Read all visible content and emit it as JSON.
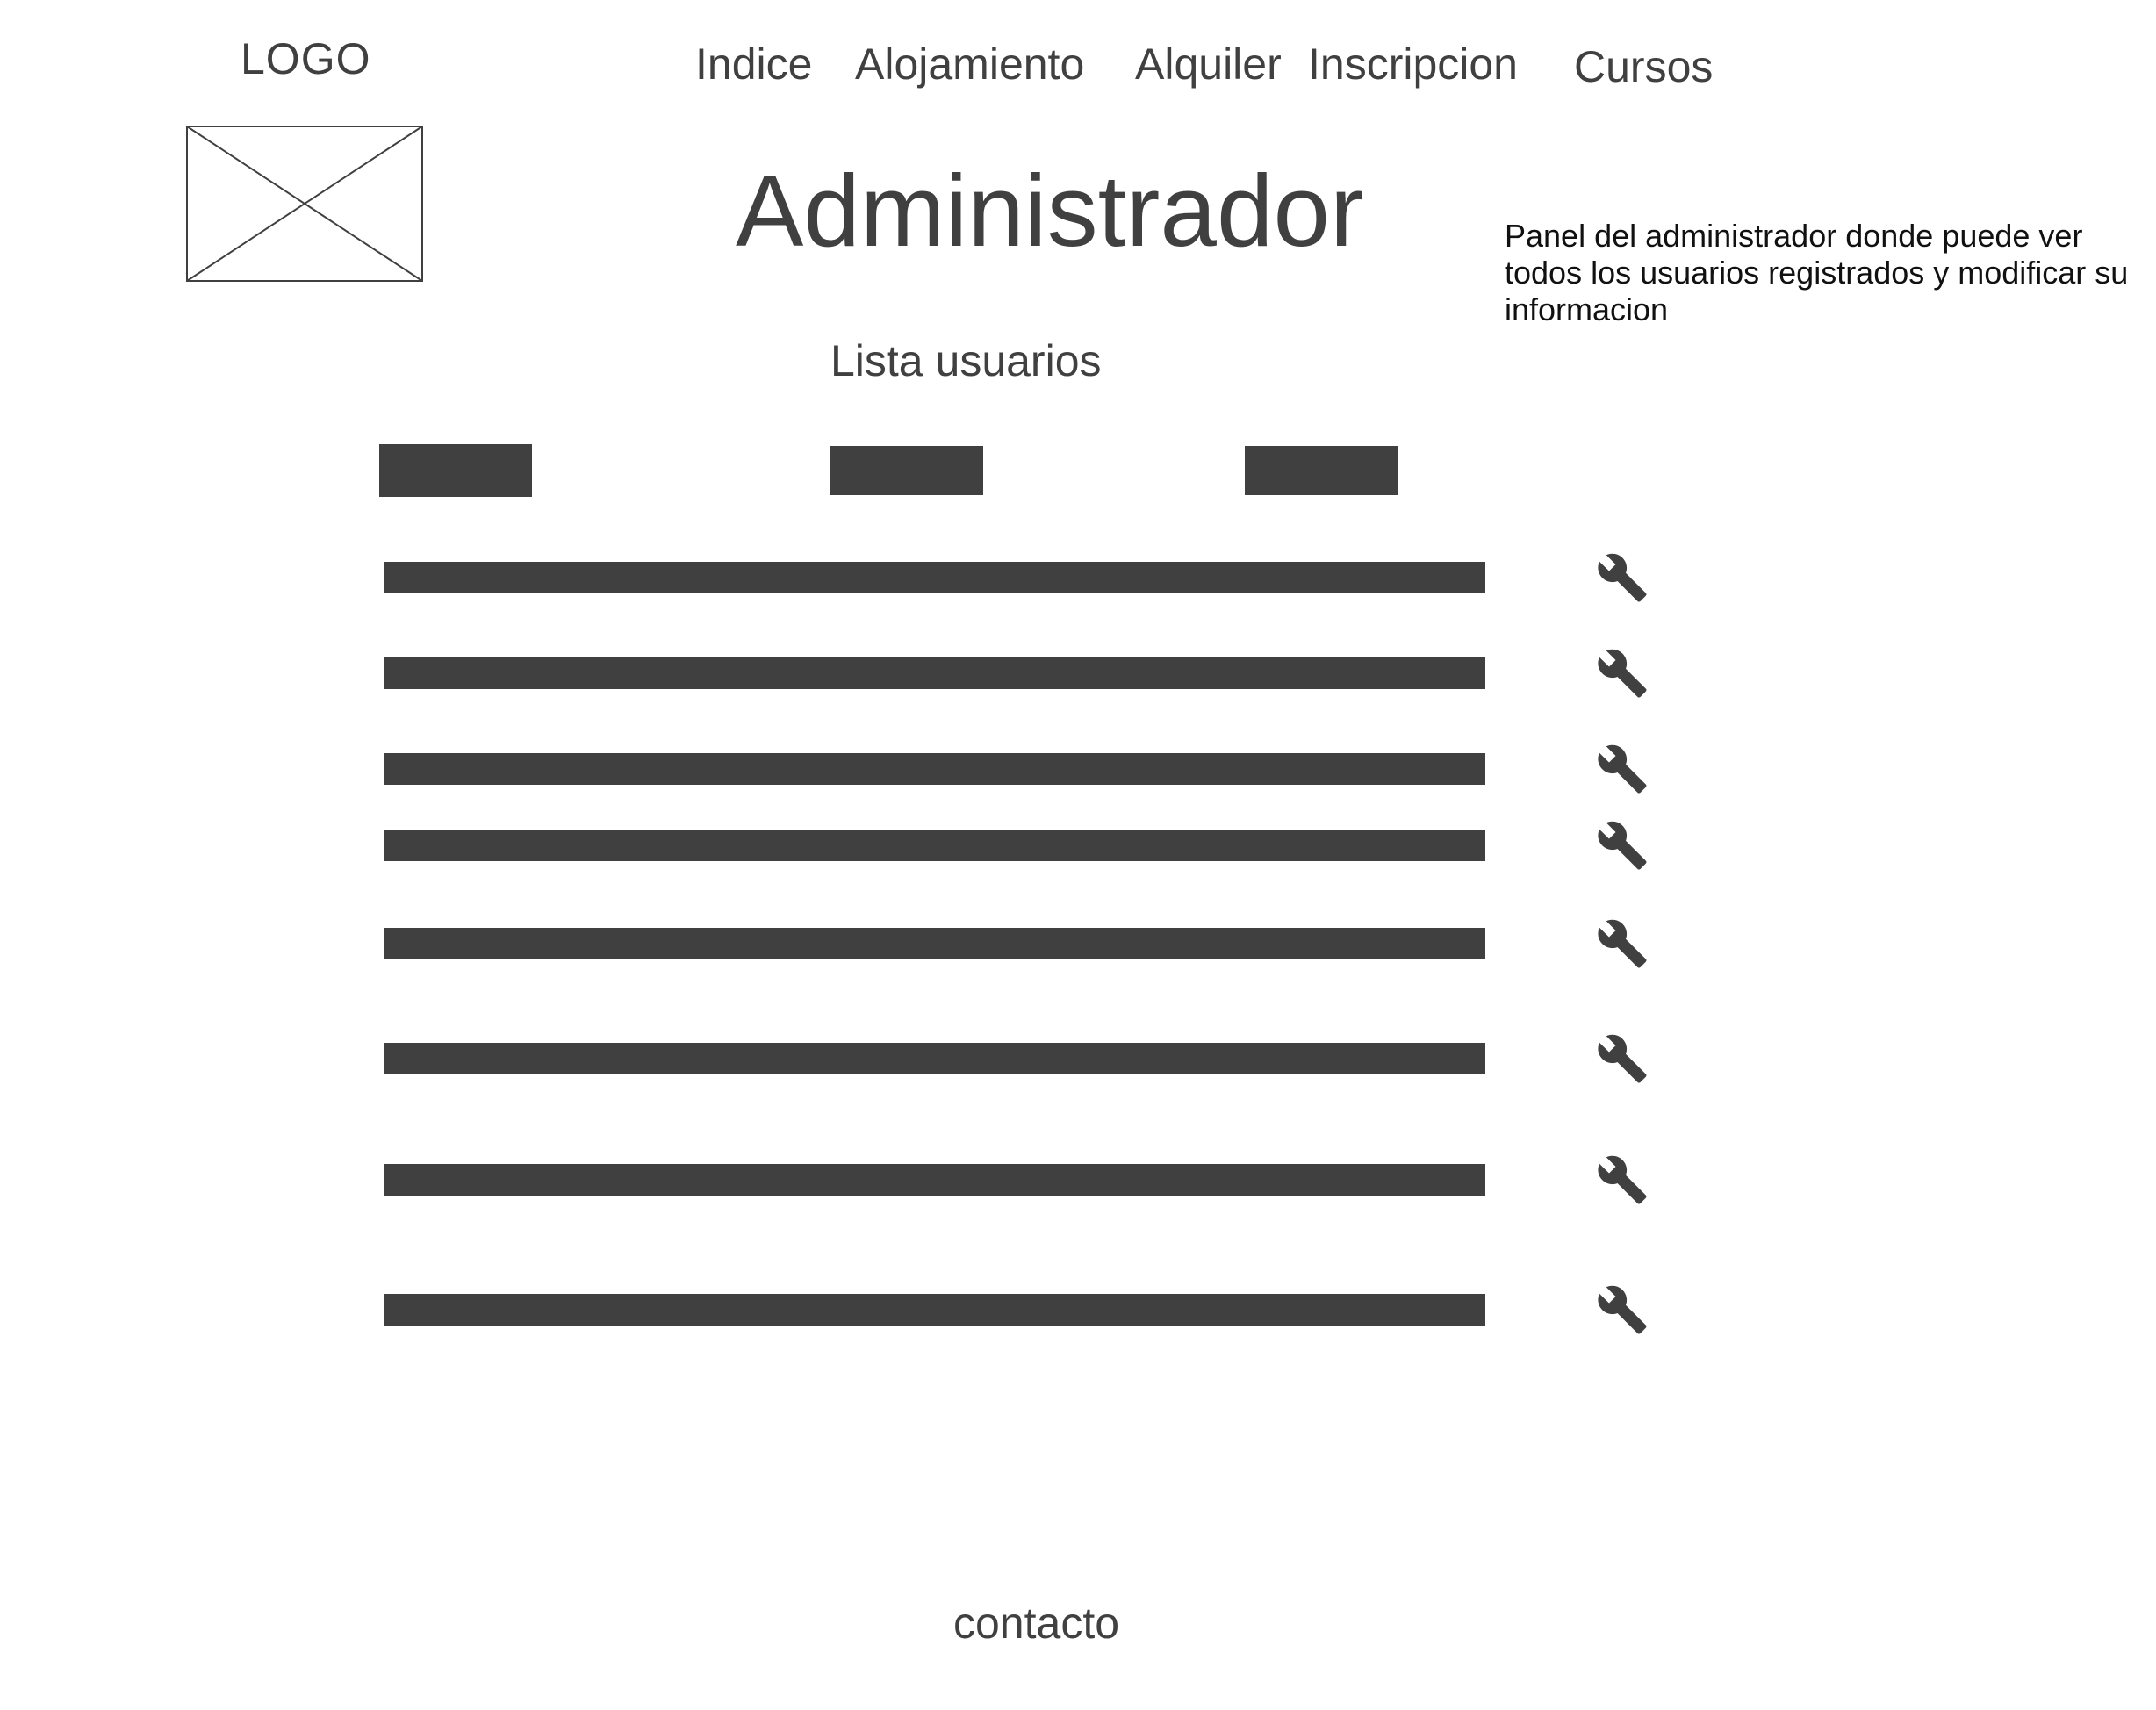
{
  "header": {
    "logo_label": "LOGO",
    "nav": {
      "indice": "Indice",
      "alojamiento": "Alojamiento",
      "alquiler": "Alquiler",
      "inscripcion": "Inscripcion",
      "cursos": "Cursos"
    }
  },
  "main": {
    "title": "Administrador",
    "description": "Panel del administrador donde puede ver todos los usuarios registrados y modificar su informacion",
    "section_title": "Lista usuarios",
    "row_action_icon": "wrench-icon"
  },
  "footer": {
    "link": "contacto"
  },
  "colors": {
    "text": "#404040",
    "placeholder_fill": "#404040",
    "description_text": "#111111"
  }
}
